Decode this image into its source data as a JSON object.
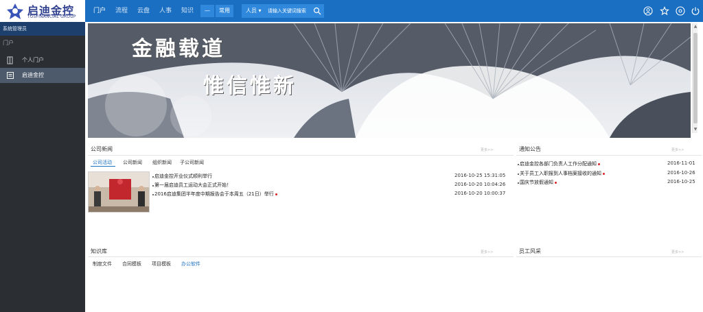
{
  "brand": {
    "name_cn": "启迪金控",
    "name_en": "TUSFINANCIAL GROUP"
  },
  "nav": {
    "items": [
      "门户",
      "流程",
      "云盘",
      "人事",
      "知识"
    ],
    "active_index": 0,
    "more_label": "—",
    "common_label": "常用"
  },
  "search": {
    "category": "人员",
    "placeholder": "请输入关键词搜索"
  },
  "header_icons": [
    "user-icon",
    "star-icon",
    "settings-icon",
    "power-icon"
  ],
  "sidebar": {
    "title": "系统管理员",
    "group": "门户",
    "items": [
      {
        "label": "个人门户",
        "icon": "portal-icon",
        "active": false
      },
      {
        "label": "启迪金控",
        "icon": "document-icon",
        "active": true
      }
    ]
  },
  "banner": {
    "line1": "金融载道",
    "line2": "惟信惟新"
  },
  "company_news": {
    "title": "公司新闻",
    "tools": "更多>>",
    "tabs": [
      "公司活动",
      "公司新闻",
      "组织新闻",
      "子公司新闻"
    ],
    "active_tab": 0,
    "rows": [
      {
        "text": "启迪金控开业仪式顺利举行",
        "date": "2016-10-25  15:31:05",
        "new": false
      },
      {
        "text": "第一届启迪员工运动大会正式开始！",
        "date": "2016-10-20  10:04:26",
        "new": false
      },
      {
        "text": "2016启迪集团半年度中期报告会于本周五（21日）举行",
        "date": "2016-10-20  10:00:37",
        "new": true
      }
    ]
  },
  "notices": {
    "title": "通知公告",
    "tools": "更多>>",
    "rows": [
      {
        "text": "启迪金控各部门负责人工作分配通知",
        "date": "2016-11-01",
        "new": true
      },
      {
        "text": "关于员工入职报到人事档案接收的通知",
        "date": "2016-10-26",
        "new": true
      },
      {
        "text": "国庆节放假通知",
        "date": "2016-10-25",
        "new": true
      }
    ]
  },
  "knowledge": {
    "title": "知识库",
    "tools": "更多>>",
    "tabs": [
      "制度文件",
      "合同模板",
      "项目模板",
      "办公软件"
    ],
    "active_tab": 3
  },
  "employee_style": {
    "title": "员工风采",
    "tools": "更多>>"
  },
  "colors": {
    "header": "#1a6fc2",
    "sidebar": "#2b2e33",
    "sidebar_active": "#4d5a6b",
    "accent": "#1a6fc2",
    "new_dot": "#e02020"
  }
}
